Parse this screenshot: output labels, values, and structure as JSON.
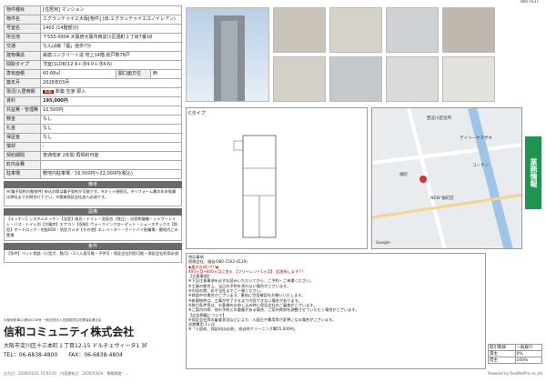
{
  "ref_no": "8857037",
  "specs": [
    {
      "label": "物件種目",
      "value": "[住居用] マンション"
    },
    {
      "label": "物件名",
      "value": "エグランテゥイエ大阪[物件] (旧:エグランテゥイエ江ノイレアン)"
    },
    {
      "label": "号室名",
      "value": "1403 (14階部分)"
    },
    {
      "label": "所在地",
      "value": "〒555-0004 大阪府大阪市西淀川区福町２丁目7番18"
    },
    {
      "label": "交通",
      "value": "なんば線「福」徒歩7分"
    },
    {
      "label": "建物構造",
      "value": "鉄筋コンクリート造 地上14階 総戸数78戸"
    },
    {
      "label": "間取タイプ",
      "value": "洋室(1LDK(12.9＋洋4.0＋洋4.6)"
    },
    {
      "label": "専有面積",
      "value": "60.68㎡",
      "extra_label": "開口面方位",
      "extra_value": "西"
    },
    {
      "label": "築年月",
      "value": "2026年03月"
    },
    {
      "label": "現況/入居時期",
      "value": "新築 空家 即入"
    },
    {
      "label": "賃料",
      "value": "195,000円"
    },
    {
      "label": "共益費・管理費",
      "value": "10,500円"
    },
    {
      "label": "敷金",
      "value": "なし"
    },
    {
      "label": "礼金",
      "value": "なし"
    },
    {
      "label": "保証金",
      "value": "なし"
    },
    {
      "label": "償却",
      "value": "-"
    },
    {
      "label": "契約期間",
      "value": "普通借家 2年間 再契約可能"
    },
    {
      "label": "町内会費",
      "value": ""
    },
    {
      "label": "駐車場",
      "value": "敷地内駐車場／16,500円～22,000円(税込)"
    }
  ],
  "status_badge": "新築",
  "notes_header": "備考",
  "notes": "※[電子契約対象物件] 申込の際は電子契約が可能です。※ネット接続可。※リフォーム費の年末換算は弊社までお問合せ下さい。※賃貸保証会社加入必須です。",
  "equipment_header": "設備",
  "equipment": "【キッチン】システムキッチン【浴室】風呂・トイレ・洗面台（独立）・浴室乾燥機・シャワートイレ・バス・トイレ別【冷暖房】エアコン【収納】ウォークインクローゼット・シューズボックス【防犯】オートロック・宅配BOX・防犯カメラ【その他】エレベーター・オートバイ駐輪場・敷地内ごみ置場",
  "conditions_header": "条件",
  "conditions": "【条件】ペット相談（小型犬、猫可）・2人入居可能・子供可・保証会社利用可能・保証会社利用必須",
  "floorplan_label": "Cタイプ",
  "map_labels": [
    "西淀川区役所",
    "福町",
    "デイリーヤマザキ",
    "コーナン",
    "NEW 福町店",
    "Google"
  ],
  "remarks": [
    "特記事項",
    "保険会社：福祉(080-1502-4129)",
    "◆重点告知!!!!!!◆",
    "400ヶ月→400ヶ月に加え 【フリーレント1ヶ月】 追加致します!!!",
    "【注意事項】",
    "※下記注意事項を必ずお読みいただいてから、ご予約・ご来場ください。",
    "※工事の都合上、当日の予約を承れない場合がございます。",
    "※内見の際、必ず当社までご一報ください。",
    "※商談中の場合がございます。事前に空室確認をお願いいたします。",
    "※新築物件は、工事が完了するまで内見できない場合があります。",
    "※取引条件等は、お客様のお申し込み時に保証会社のご審査がございます。",
    "※ご案内の際、他の予約との重複がある場合、ご案内時刻を調整させていただく場合がございます。",
    "【広告掲載について】",
    "※保証会社等の審査状況などにより、入居日や費用等が変更になる場合がございます。",
    "初期費用 1ヶ月",
    "※「入居前、保証料は必須」 退去時クリーニング費55,000円。"
  ],
  "side_tab": "業務情報",
  "company": {
    "license": "大阪府知事(2)第60336号 一般社団法人全国賃貸住宅業協会連合会",
    "name": "信和コミュニティ株式会社",
    "address": "大阪市淀川区十三本町１丁目12-15 ドルチェヴィータ1 3F",
    "tel": "TEL：06-6838-4800",
    "fax": "FAX：06-6838-4804"
  },
  "trade": {
    "title": "取引態様",
    "value": "一般媒介",
    "rows": [
      [
        "貸主",
        "0%"
      ],
      [
        "借主",
        "100%"
      ]
    ]
  },
  "footer_left": "出力日：2026/03/21 15:03:41　内容更新日：2026/03/04　情報鮮度：…",
  "footer_right": "Powered by RealNetPro co.,ltd"
}
